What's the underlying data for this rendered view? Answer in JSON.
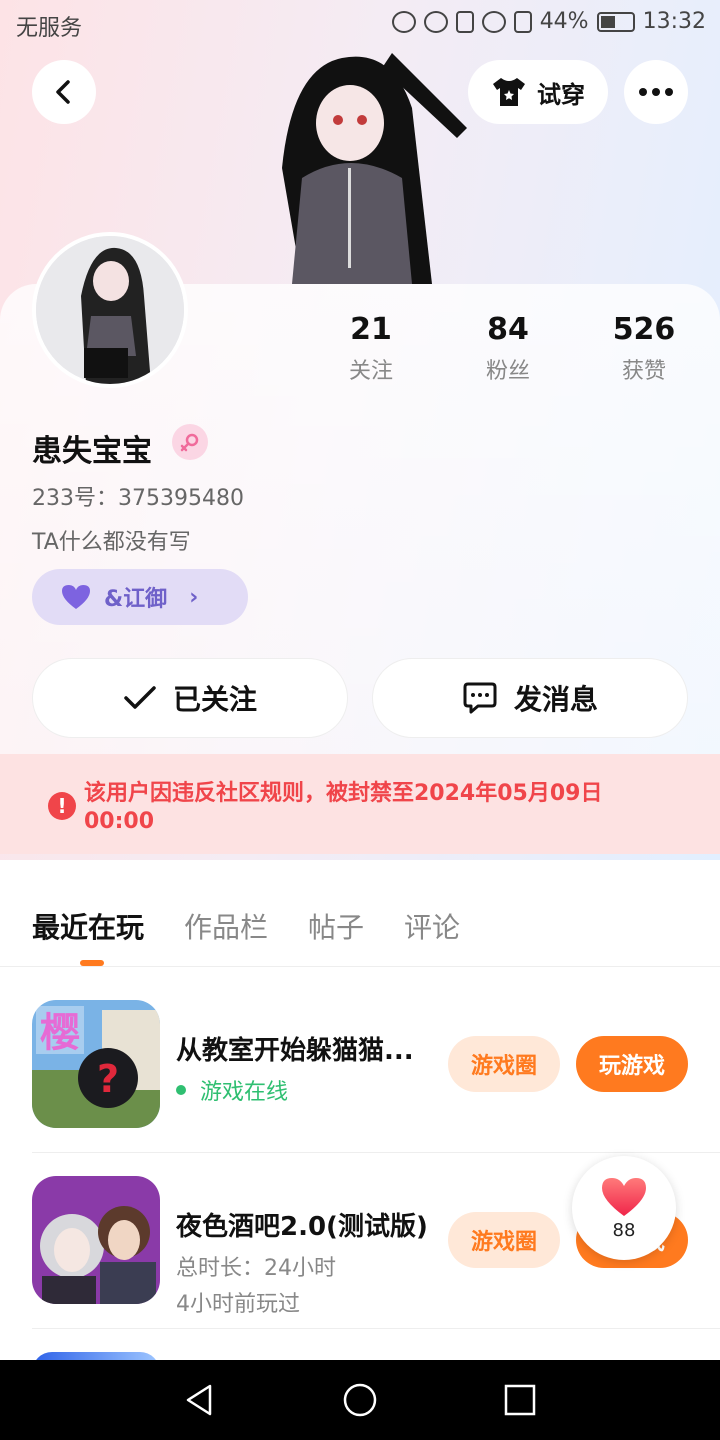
{
  "status_bar": {
    "carrier": "无服务",
    "battery": "44%",
    "time": "13:32"
  },
  "header": {
    "tryon_label": "试穿"
  },
  "profile": {
    "name": "患失宝宝",
    "uid": "233号：375395480",
    "bio": "TA什么都没有写",
    "tag_label": "&讧御",
    "stats": [
      {
        "value": "21",
        "label": "关注"
      },
      {
        "value": "84",
        "label": "粉丝"
      },
      {
        "value": "526",
        "label": "获赞"
      }
    ],
    "follow_label": "已关注",
    "message_label": "发消息"
  },
  "ban_notice": "该用户因违反社区规则，被封禁至2024年05月09日 00:00",
  "tabs": [
    "最近在玩",
    "作品栏",
    "帖子",
    "评论"
  ],
  "games": [
    {
      "title": "从教室开始躲猫猫...",
      "status": "游戏在线",
      "circle_label": "游戏圈",
      "play_label": "玩游戏",
      "icon_text": "樱"
    },
    {
      "title": "夜色酒吧2.0(测试版)",
      "duration": "总时长：24小时",
      "last_played": "4小时前玩过",
      "circle_label": "游戏圈",
      "play_label": "玩游戏"
    }
  ],
  "like_bubble": {
    "count": "88"
  }
}
